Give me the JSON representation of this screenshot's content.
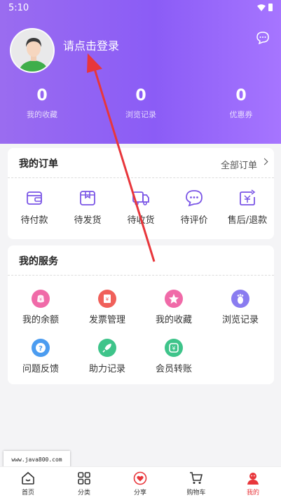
{
  "status": {
    "time": "5:10"
  },
  "profile": {
    "login_prompt": "请点击登录"
  },
  "stats": [
    {
      "value": "0",
      "label": "我的收藏"
    },
    {
      "value": "0",
      "label": "浏览记录"
    },
    {
      "value": "0",
      "label": "优惠券"
    }
  ],
  "orders": {
    "title": "我的订单",
    "all_label": "全部订单",
    "items": [
      {
        "label": "待付款",
        "icon": "wallet-icon"
      },
      {
        "label": "待发货",
        "icon": "package-icon"
      },
      {
        "label": "待收货",
        "icon": "truck-icon"
      },
      {
        "label": "待评价",
        "icon": "comment-icon"
      },
      {
        "label": "售后/退款",
        "icon": "refund-icon"
      }
    ]
  },
  "services": {
    "title": "我的服务",
    "items": [
      {
        "label": "我的余额",
        "icon": "balance-icon",
        "color": "#f06aa8"
      },
      {
        "label": "发票管理",
        "icon": "invoice-icon",
        "color": "#f0605a"
      },
      {
        "label": "我的收藏",
        "icon": "star-icon",
        "color": "#f06aa8"
      },
      {
        "label": "浏览记录",
        "icon": "footprint-icon",
        "color": "#8a7cf0"
      },
      {
        "label": "问题反馈",
        "icon": "question-icon",
        "color": "#4b9cf0"
      },
      {
        "label": "助力记录",
        "icon": "rocket-icon",
        "color": "#3ec48a"
      },
      {
        "label": "会员转账",
        "icon": "transfer-icon",
        "color": "#3ec48a"
      }
    ]
  },
  "tabs": [
    {
      "label": "首页",
      "icon": "home-icon",
      "active": false
    },
    {
      "label": "分类",
      "icon": "grid-icon",
      "active": false
    },
    {
      "label": "分享",
      "icon": "share-icon",
      "active": false
    },
    {
      "label": "购物车",
      "icon": "cart-icon",
      "active": false
    },
    {
      "label": "我的",
      "icon": "profile-icon",
      "active": true
    }
  ],
  "watermark": "www.java800.com",
  "colors": {
    "header_gradient_start": "#9a6cf0",
    "header_gradient_end": "#a675ff",
    "accent_active": "#e8363b",
    "arrow": "#e8363b"
  }
}
